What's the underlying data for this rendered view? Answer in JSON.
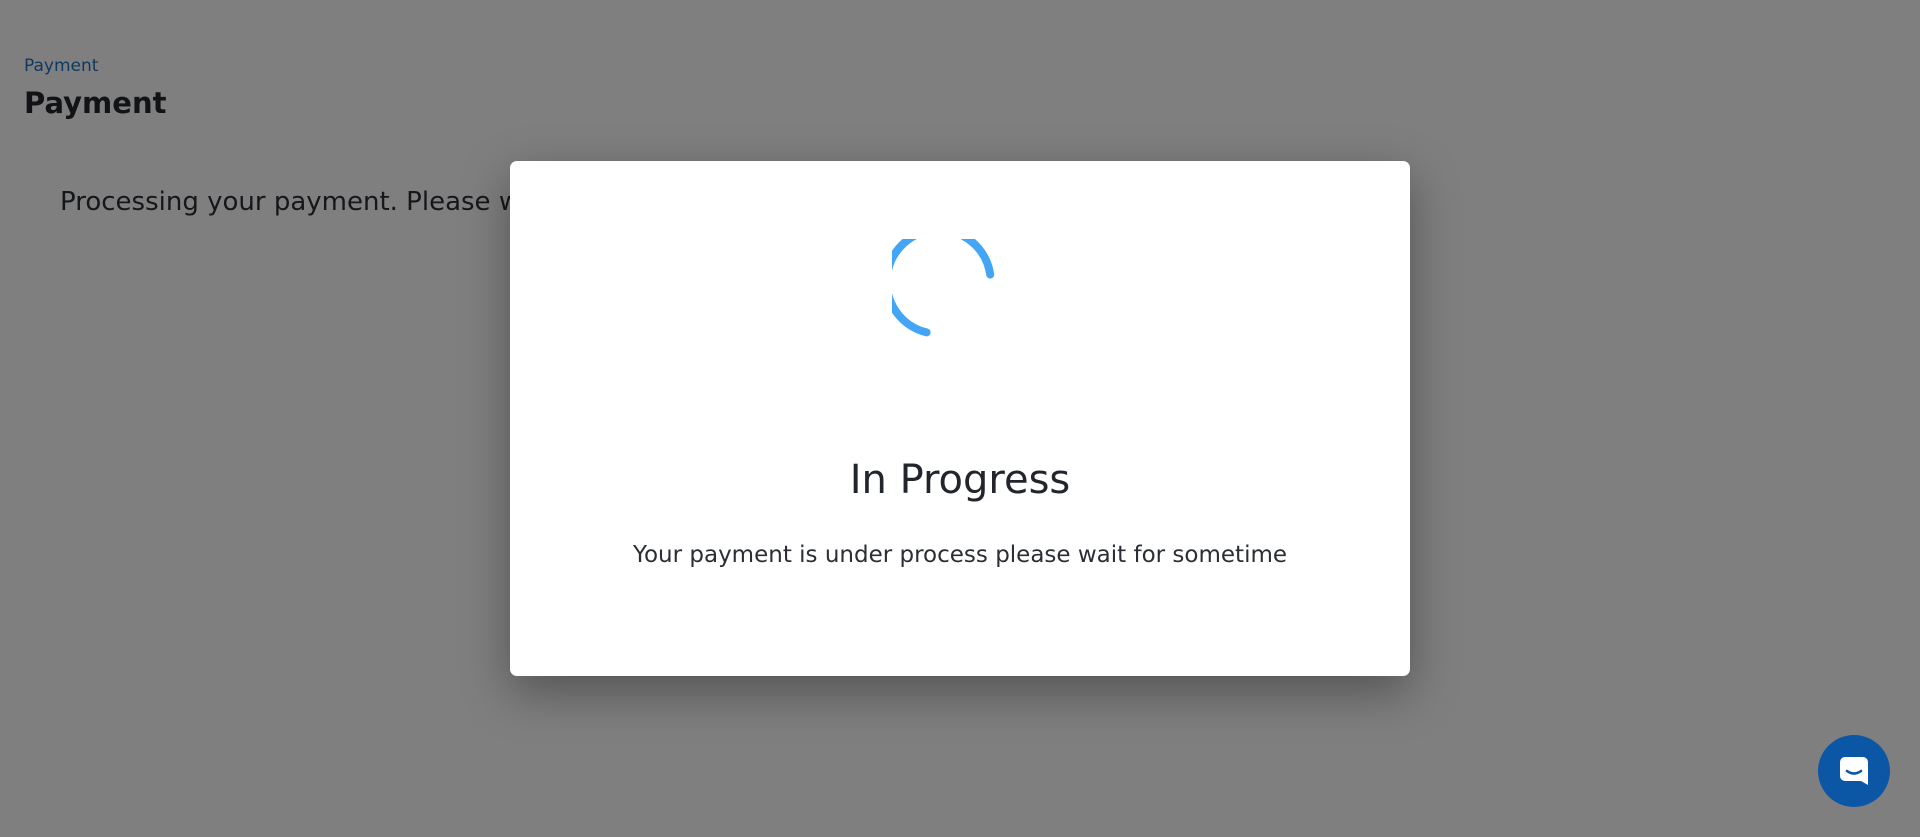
{
  "colors": {
    "breadcrumb_link": "#1f73c7",
    "spinner": "#42a5f5",
    "chat_button": "#0b57a5",
    "overlay": "rgba(0,0,0,0.5)"
  },
  "breadcrumb": {
    "label": "Payment"
  },
  "page": {
    "title": "Payment",
    "processing_message": "Processing your payment. Please wait"
  },
  "modal": {
    "spinner_icon": "loading-spinner",
    "title": "In Progress",
    "message": "Your payment is under process please wait for sometime"
  },
  "chat_widget": {
    "icon": "chat-icon"
  }
}
